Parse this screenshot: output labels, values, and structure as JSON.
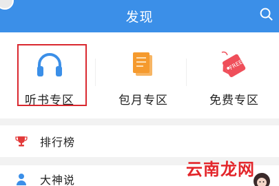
{
  "header": {
    "title": "发现",
    "search_icon": "search-icon"
  },
  "categories": [
    {
      "label": "听书专区",
      "icon": "headphones-icon",
      "color": "#3b8fe8",
      "selected": true
    },
    {
      "label": "包月专区",
      "icon": "stacked-books-icon",
      "color": "#f59a2e"
    },
    {
      "label": "免费专区",
      "icon": "free-tag-icon",
      "color": "#ef4f5a"
    }
  ],
  "list": [
    {
      "label": "排行榜",
      "icon": "trophy-icon",
      "color": "#e23a3a"
    },
    {
      "label": "大神说",
      "icon": "person-icon",
      "color": "#3b8fe8"
    }
  ],
  "free_tag_text": "FREE",
  "watermark": "云南龙网",
  "colors": {
    "header_bg": "#3b8fe8",
    "highlight": "#d9272e"
  }
}
